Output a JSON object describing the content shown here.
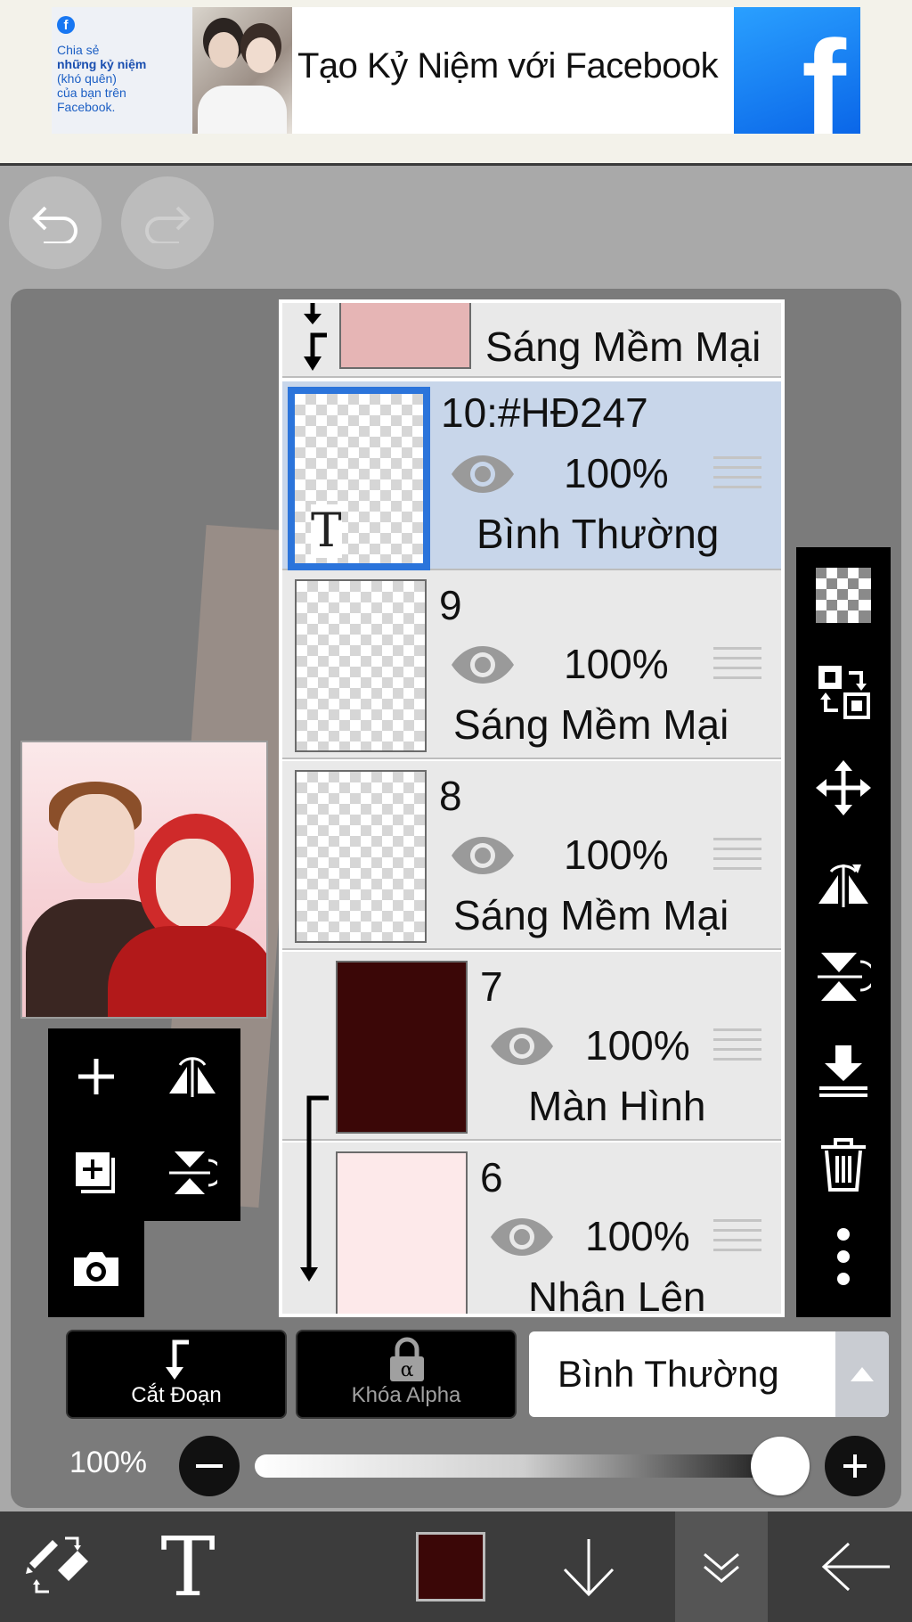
{
  "ad": {
    "fb_mini": "f",
    "share_line1": "Chia sẻ",
    "share_line2": "những kỷ niệm",
    "share_line3": "(khó quên)",
    "share_line4": "của bạn trên",
    "share_line5": "Facebook.",
    "title": "Tạo Kỷ Niệm với Facebook",
    "logo_letter": "f"
  },
  "layers": [
    {
      "name": "",
      "opacity": "",
      "mode": "Sáng Mềm Mại",
      "clipped": true,
      "partial": true
    },
    {
      "name": "10:#HĐ247",
      "opacity": "100%",
      "mode": "Bình Thường",
      "selected": true,
      "thumb_letter": "T"
    },
    {
      "name": "9",
      "opacity": "100%",
      "mode": "Sáng Mềm Mại"
    },
    {
      "name": "8",
      "opacity": "100%",
      "mode": "Sáng Mềm Mại"
    },
    {
      "name": "7",
      "opacity": "100%",
      "mode": "Màn Hình",
      "clipped": true
    },
    {
      "name": "6",
      "opacity": "100%",
      "mode": "Nhân Lên",
      "clipped": true
    }
  ],
  "controls": {
    "clip_label": "Cắt Đoạn",
    "alpha_label": "Khóa Alpha",
    "blend_mode": "Bình Thường",
    "opacity_value": "100%",
    "opacity_level": 1.0
  },
  "icons": {
    "undo": "undo-icon",
    "redo": "redo-icon",
    "right_bar": [
      "checker-icon",
      "swap-layer-icon",
      "move-icon",
      "flip-horizontal-icon",
      "flip-vertical-icon",
      "merge-down-icon",
      "trash-icon",
      "more-icon"
    ],
    "nav": [
      "brush-eraser-toggle-icon",
      "text-icon",
      "color-swatch",
      "arrow-down-icon",
      "double-chevron-down-icon",
      "back-arrow-icon"
    ]
  },
  "colors": {
    "current_color": "#3b0707",
    "selection_blue": "#2b74db"
  }
}
